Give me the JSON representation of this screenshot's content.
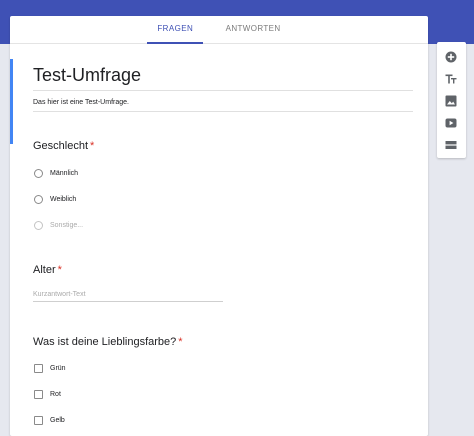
{
  "tabs": [
    {
      "label": "FRAGEN"
    },
    {
      "label": "ANTWORTEN"
    }
  ],
  "form": {
    "title": "Test-Umfrage",
    "description": "Das hier ist eine Test-Umfrage."
  },
  "questions": [
    {
      "title": "Geschlecht",
      "required_mark": "*",
      "type": "radio",
      "options": [
        {
          "label": "Männlich"
        },
        {
          "label": "Weiblich"
        },
        {
          "label": "Sonstige..."
        }
      ]
    },
    {
      "title": "Alter",
      "required_mark": "*",
      "type": "short-answer",
      "placeholder": "Kurzantwort-Text"
    },
    {
      "title": "Was ist deine Lieblingsfarbe?",
      "required_mark": "*",
      "type": "checkbox",
      "options": [
        {
          "label": "Grün"
        },
        {
          "label": "Rot"
        },
        {
          "label": "Gelb"
        }
      ]
    }
  ],
  "toolbar": {
    "icons": [
      "add-question-icon",
      "title-text-icon",
      "image-icon",
      "video-icon",
      "section-icon"
    ]
  },
  "colors": {
    "header": "#3f51b5",
    "accent": "#4285f4",
    "required": "#d93025"
  }
}
